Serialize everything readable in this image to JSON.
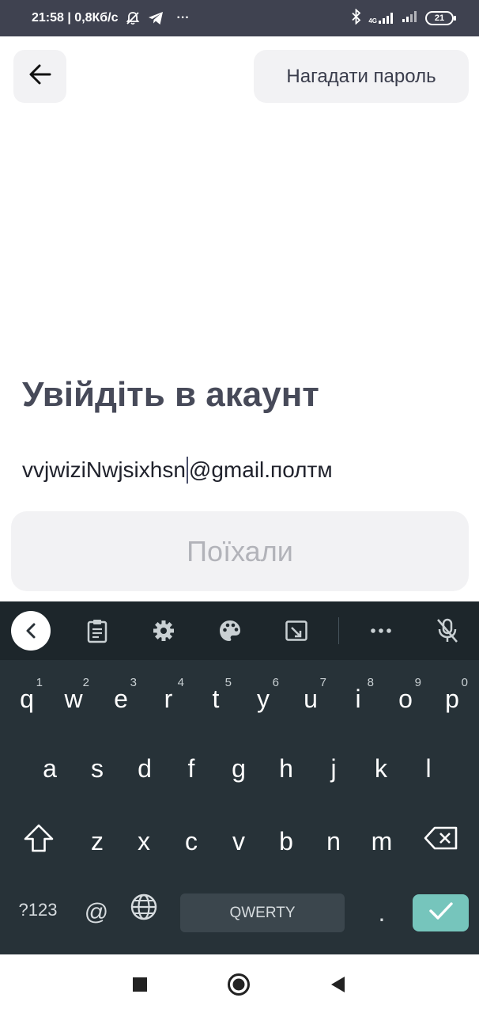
{
  "status_bar": {
    "time_speed": "21:58 | 0,8Кб/с",
    "more": "···",
    "network": "4G",
    "battery": "21"
  },
  "header": {
    "back_icon": "arrow-left-icon",
    "remind_label": "Нагадати пароль"
  },
  "login": {
    "title": "Увійдіть в акаунт",
    "email_before_cursor": "vvjwiziNwjsixhsn",
    "email_after_cursor": "@gmail.полтм",
    "submit_label": "Поїхали"
  },
  "keyboard": {
    "toolbar_icons": [
      "chevron-left-icon",
      "clipboard-icon",
      "gear-icon",
      "palette-icon",
      "resize-icon",
      "more-icon",
      "mic-off-icon"
    ],
    "row1": [
      {
        "key": "q",
        "hint": "1"
      },
      {
        "key": "w",
        "hint": "2"
      },
      {
        "key": "e",
        "hint": "3"
      },
      {
        "key": "r",
        "hint": "4"
      },
      {
        "key": "t",
        "hint": "5"
      },
      {
        "key": "y",
        "hint": "6"
      },
      {
        "key": "u",
        "hint": "7"
      },
      {
        "key": "i",
        "hint": "8"
      },
      {
        "key": "o",
        "hint": "9"
      },
      {
        "key": "p",
        "hint": "0"
      }
    ],
    "row2": [
      "a",
      "s",
      "d",
      "f",
      "g",
      "h",
      "j",
      "k",
      "l"
    ],
    "row3": [
      "z",
      "x",
      "c",
      "v",
      "b",
      "n",
      "m"
    ],
    "symbols_label": "?123",
    "at_label": "@",
    "space_label": "QWERTY",
    "period_label": ".",
    "accent_color": "#76c5bc"
  },
  "nav_bar": {
    "icons": [
      "recents-square-icon",
      "home-circle-icon",
      "back-triangle-icon"
    ]
  }
}
